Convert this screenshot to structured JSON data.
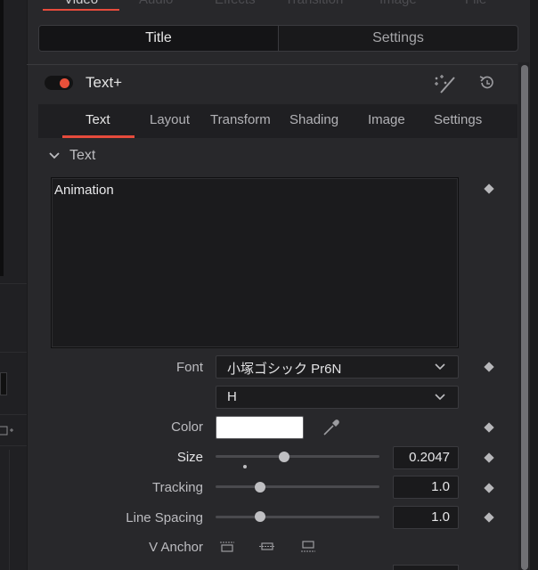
{
  "top_tabs": [
    "Video",
    "Audio",
    "Effects",
    "Transition",
    "Image",
    "File"
  ],
  "segmented": {
    "title": "Title",
    "settings": "Settings"
  },
  "header": {
    "title": "Text+",
    "enabled": true
  },
  "subtabs": [
    "Text",
    "Layout",
    "Transform",
    "Shading",
    "Image",
    "Settings"
  ],
  "active_subtab": "Text",
  "section": {
    "title": "Text"
  },
  "text_value": "Animation",
  "font": {
    "label": "Font",
    "family": "小塚ゴシック Pr6N",
    "style": "H"
  },
  "color": {
    "label": "Color",
    "value": "#ffffff"
  },
  "size": {
    "label": "Size",
    "value": "0.2047",
    "slider_fraction": 0.42
  },
  "tracking": {
    "label": "Tracking",
    "value": "1.0",
    "slider_fraction": 0.27
  },
  "line_spacing": {
    "label": "Line Spacing",
    "value": "1.0",
    "slider_fraction": 0.27
  },
  "v_anchor": {
    "label": "V Anchor"
  },
  "accent_color": "#e64b3c"
}
